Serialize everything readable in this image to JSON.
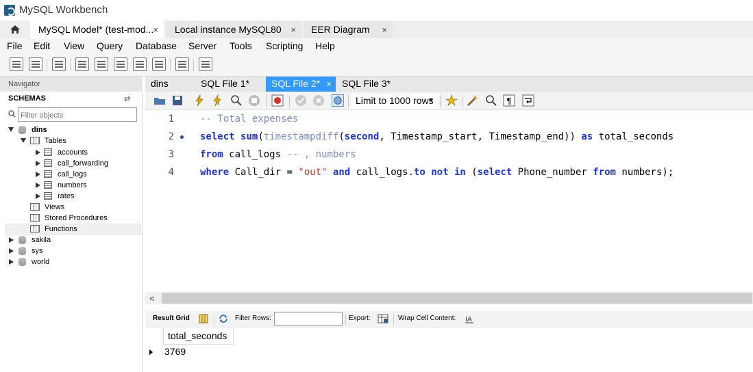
{
  "app": {
    "title": "MySQL Workbench"
  },
  "doc_tabs": [
    {
      "label": "MySQL Model* (test-mod...",
      "close": "×"
    },
    {
      "label": "Local instance MySQL80",
      "close": "×"
    },
    {
      "label": "EER Diagram",
      "close": "×"
    }
  ],
  "menu": [
    "File",
    "Edit",
    "View",
    "Query",
    "Database",
    "Server",
    "Tools",
    "Scripting",
    "Help"
  ],
  "navigator": {
    "header": "Navigator",
    "schemas_label": "SCHEMAS",
    "filter_placeholder": "Filter objects",
    "schemas": [
      {
        "name": "dins",
        "expanded": true
      },
      {
        "name": "sakila",
        "expanded": false
      },
      {
        "name": "sys",
        "expanded": false
      },
      {
        "name": "world",
        "expanded": false
      }
    ],
    "tables_label": "Tables",
    "tables": [
      "accounts",
      "call_forwarding",
      "call_logs",
      "numbers",
      "rates"
    ],
    "selected_table": "accounts",
    "folders": [
      "Views",
      "Stored Procedures",
      "Functions"
    ]
  },
  "editor_tabs": [
    {
      "label": "dins"
    },
    {
      "label": "SQL File 1*"
    },
    {
      "label": "SQL File 2*",
      "active": true,
      "close": "×"
    },
    {
      "label": "SQL File 3*"
    }
  ],
  "editor_toolbar": {
    "limit": "Limit to 1000 rows"
  },
  "code": {
    "line_numbers": [
      "1",
      "2",
      "3",
      "4"
    ],
    "line1_comment": "-- Total expenses",
    "line2": {
      "select": "select",
      "sum": "sum",
      "p1": "(",
      "tsd": "timestampdiff",
      "p2": "(",
      "second": "second",
      "rest": ", Timestamp_start, Timestamp_end)) ",
      "as": "as",
      "alias": " total_seconds"
    },
    "line3": {
      "from": "from",
      "table": " call_logs ",
      "comment": "-- , numbers"
    },
    "line4": {
      "where": "where",
      "col": " Call_dir = ",
      "str": "\"out\"",
      "sp1": " ",
      "and": "and",
      "ref": " call_logs.",
      "to": "to",
      "sp2": " ",
      "not": "not",
      "sp3": " ",
      "in": "in",
      "sp4": " (",
      "select": "select",
      "pn": " Phone_number ",
      "from": "from",
      "end": " numbers);"
    }
  },
  "result_toolbar": {
    "result_grid": "Result Grid",
    "filter_rows": "Filter Rows:",
    "export": "Export:",
    "wrap": "Wrap Cell Content:"
  },
  "result": {
    "columns": [
      "total_seconds"
    ],
    "rows": [
      [
        "3769"
      ]
    ]
  },
  "colors": {
    "active_tab": "#3399ff",
    "keyword": "#1b32d7",
    "comment": "#7a8ccc",
    "string": "#b03a2e"
  }
}
